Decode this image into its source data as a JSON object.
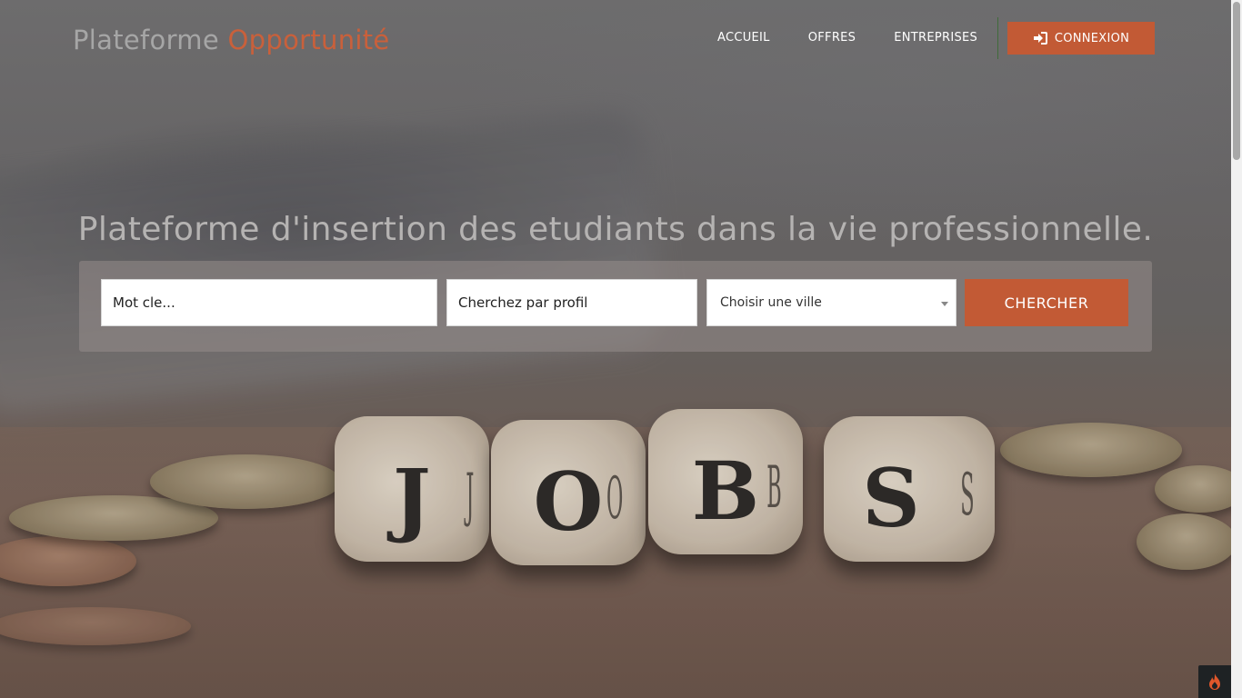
{
  "brand": {
    "part1": "Plateforme",
    "part2": "Opportunité"
  },
  "nav": {
    "links": [
      "ACCUEIL",
      "OFFRES",
      "ENTREPRISES"
    ],
    "login_label": "CONNEXION"
  },
  "hero": {
    "title": "Plateforme d'insertion des etudiants dans la vie professionnelle."
  },
  "search": {
    "keyword_placeholder": "Mot cle...",
    "profile_placeholder": "Cherchez par profil",
    "city_selected": "Choisir une ville",
    "button_label": "CHERCHER"
  },
  "background": {
    "dice_letters": [
      "J",
      "O",
      "B",
      "S"
    ]
  },
  "colors": {
    "accent": "#c25a35",
    "brand_secondary": "#c9603b",
    "brand_primary": "#a6a6a6"
  },
  "icons": {
    "login": "sign-in-icon",
    "corner": "flame-icon"
  }
}
